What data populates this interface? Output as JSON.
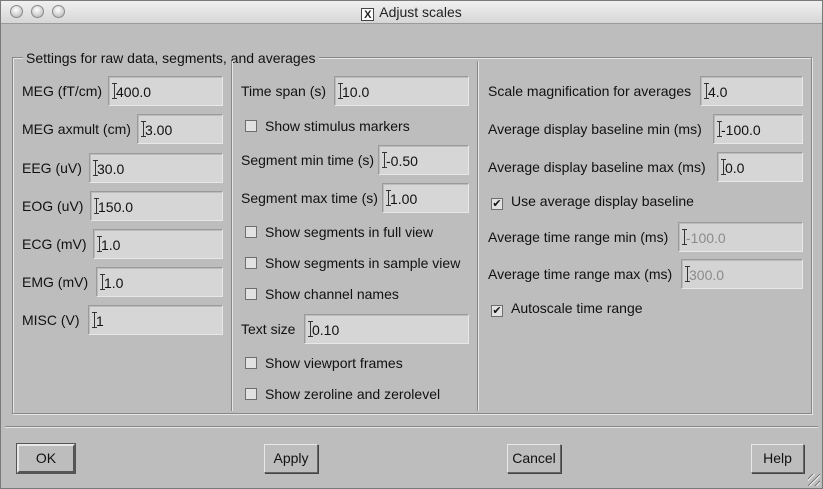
{
  "window": {
    "title": "Adjust scales",
    "x11_icon_glyph": "X",
    "controls": [
      "close",
      "minimize",
      "zoom"
    ]
  },
  "group": {
    "title": "Settings for raw data, segments, and averages"
  },
  "column1": {
    "meg": {
      "label": "MEG (fT/cm)",
      "value": "400.0"
    },
    "meg_axmult": {
      "label": "MEG axmult (cm)",
      "value": "3.00"
    },
    "eeg": {
      "label": "EEG (uV)",
      "value": "30.0"
    },
    "eog": {
      "label": "EOG (uV)",
      "value": "150.0"
    },
    "ecg": {
      "label": "ECG (mV)",
      "value": "1.0"
    },
    "emg": {
      "label": "EMG (mV)",
      "value": "1.0"
    },
    "misc": {
      "label": "MISC (V)",
      "value": "1"
    }
  },
  "column2": {
    "time_span": {
      "label": "Time span (s)",
      "value": "10.0"
    },
    "show_stimulus_markers": {
      "label": "Show stimulus markers",
      "checked": false
    },
    "segment_min": {
      "label": "Segment min time (s)",
      "value": "-0.50"
    },
    "segment_max": {
      "label": "Segment max time (s)",
      "value": "1.00"
    },
    "show_segments_full": {
      "label": "Show segments in full view",
      "checked": false
    },
    "show_segments_sample": {
      "label": "Show segments in sample view",
      "checked": false
    },
    "show_channel_names": {
      "label": "Show channel names",
      "checked": false
    },
    "text_size": {
      "label": "Text size",
      "value": "0.10"
    },
    "show_viewport_frames": {
      "label": "Show viewport frames",
      "checked": false
    },
    "show_zeroline": {
      "label": "Show zeroline and zerolevel",
      "checked": false
    }
  },
  "column3": {
    "scale_mag": {
      "label": "Scale magnification for averages",
      "value": "4.0"
    },
    "baseline_min": {
      "label": "Average display baseline min (ms)",
      "value": "-100.0"
    },
    "baseline_max": {
      "label": "Average display baseline max (ms)",
      "value": "0.0"
    },
    "use_baseline": {
      "label": "Use average display baseline",
      "checked": true
    },
    "time_range_min": {
      "label": "Average time range min (ms)",
      "value": "-100.0",
      "disabled": true
    },
    "time_range_max": {
      "label": "Average time range max (ms)",
      "value": "300.0",
      "disabled": true
    },
    "autoscale": {
      "label": "Autoscale time range",
      "checked": true
    }
  },
  "buttons": {
    "ok": "OK",
    "apply": "Apply",
    "cancel": "Cancel",
    "help": "Help"
  },
  "check_glyph": "✔",
  "colors": {
    "window_bg": "#bdbdbd",
    "field_bg": "#d6d6d6",
    "disabled_text": "#8c8c8c"
  }
}
